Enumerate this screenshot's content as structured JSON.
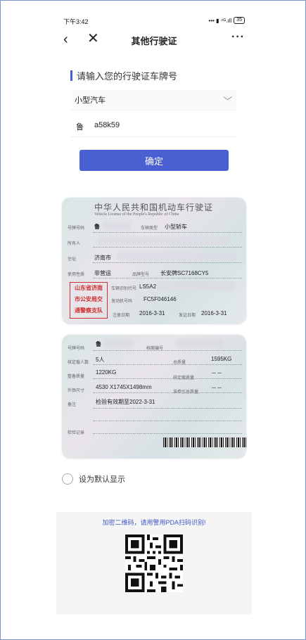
{
  "status": {
    "time": "下午3:42",
    "battery": "35"
  },
  "nav": {
    "title": "其他行驶证"
  },
  "form": {
    "section_label": "请输入您的行驶证车牌号",
    "vehicle_type": "小型汽车",
    "plate_province": "鲁",
    "plate_number": "a58k59",
    "confirm_label": "确定"
  },
  "front": {
    "heading": "中华人民共和国机动车行驶证",
    "subheading": "Vehicle License of the People's Republic of China",
    "plate_label": "号牌号码",
    "plate_value": "鲁",
    "type_label": "车辆类型",
    "type_value": "小型轿车",
    "owner_label": "所有人",
    "address_label": "住址",
    "address_value": "济南市",
    "use_label": "使用性质",
    "use_value": "非营运",
    "model_label": "品牌型号",
    "model_value": "长安牌SC7168CY5",
    "vin_label": "车辆识别代号",
    "vin_value": "LS5A2",
    "engine_label": "发动机号码",
    "engine_value": "FC5F046146",
    "register_label": "注册日期",
    "register_value": "2016-3-31",
    "issue_label": "发证日期",
    "issue_value": "2016-3-31",
    "stamp_lines": [
      "山东省济南",
      "市公安局交",
      "通警察支队"
    ]
  },
  "back": {
    "plate_label": "号牌号码",
    "plate_value": "鲁",
    "file_label": "档案编号",
    "seats_label": "核定载人数",
    "seats_value": "5人",
    "total_mass_label": "总质量",
    "total_mass_value": "1595KG",
    "curb_label": "整备质量",
    "curb_value": "1220KG",
    "rated_label": "核定载质量",
    "rated_value": "－－",
    "size_label": "外廓尺寸",
    "size_value": "4530 X1745X1498mm",
    "tow_label": "准牵引总质量",
    "tow_value": "－－",
    "note_label": "备注",
    "note_value": "检验有效期至2022-3-31",
    "inspection_label": "检验记录"
  },
  "default_label": "设为默认显示",
  "qr_hint": "加密二维码，请用警用PDA扫码识别!"
}
